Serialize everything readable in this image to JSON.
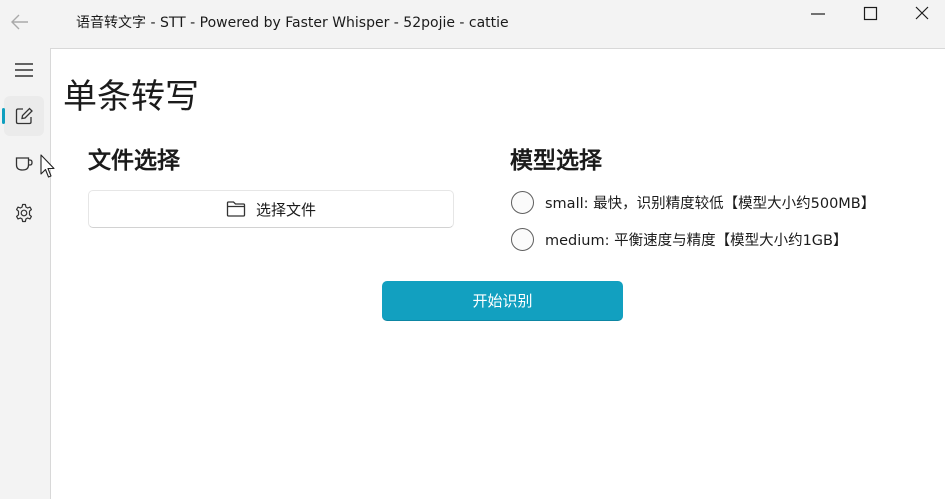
{
  "window": {
    "title": "语音转文字 - STT - Powered by Faster Whisper - 52pojie - cattie"
  },
  "page": {
    "title": "单条转写"
  },
  "file_section": {
    "title": "文件选择",
    "button_label": "选择文件"
  },
  "model_section": {
    "title": "模型选择",
    "options": [
      {
        "label": "small: 最快，识别精度较低【模型大小约500MB】",
        "selected": false
      },
      {
        "label": "medium: 平衡速度与精度【模型大小约1GB】",
        "selected": false
      }
    ]
  },
  "actions": {
    "start_label": "开始识别"
  },
  "nav": {
    "items": [
      {
        "icon": "menu-icon"
      },
      {
        "icon": "edit-icon",
        "selected": true
      },
      {
        "icon": "cup-icon"
      },
      {
        "icon": "settings-icon"
      }
    ]
  },
  "colors": {
    "accent": "#12a0c0",
    "background": "#f3f3f3",
    "content_bg": "#ffffff"
  }
}
